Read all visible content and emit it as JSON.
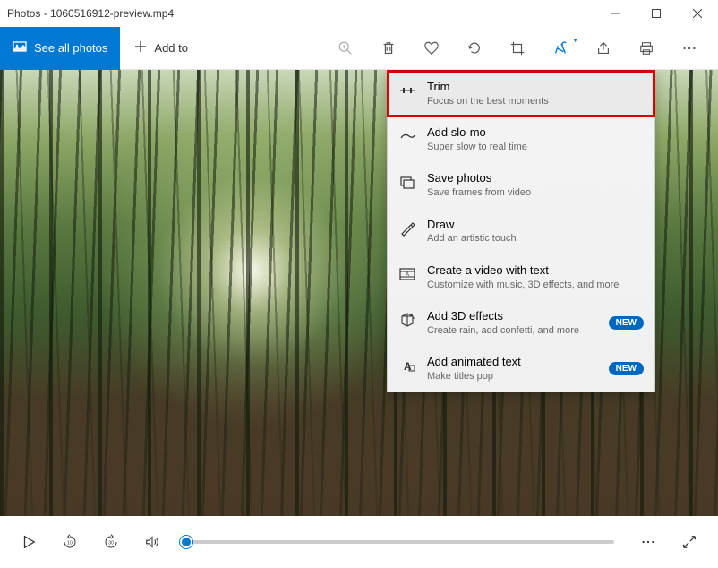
{
  "title": "Photos - 1060516912-preview.mp4",
  "toolbar": {
    "see_all": "See all photos",
    "add_to": "Add to"
  },
  "dropdown": {
    "items": [
      {
        "title": "Trim",
        "sub": "Focus on the best moments"
      },
      {
        "title": "Add slo-mo",
        "sub": "Super slow to real time"
      },
      {
        "title": "Save photos",
        "sub": "Save frames from video"
      },
      {
        "title": "Draw",
        "sub": "Add an artistic touch"
      },
      {
        "title": "Create a video with text",
        "sub": "Customize with music, 3D effects, and more"
      },
      {
        "title": "Add 3D effects",
        "sub": "Create rain, add confetti, and more",
        "badge": "NEW"
      },
      {
        "title": "Add animated text",
        "sub": "Make titles pop",
        "badge": "NEW"
      }
    ]
  },
  "skip": {
    "back": "10",
    "fwd": "30"
  }
}
